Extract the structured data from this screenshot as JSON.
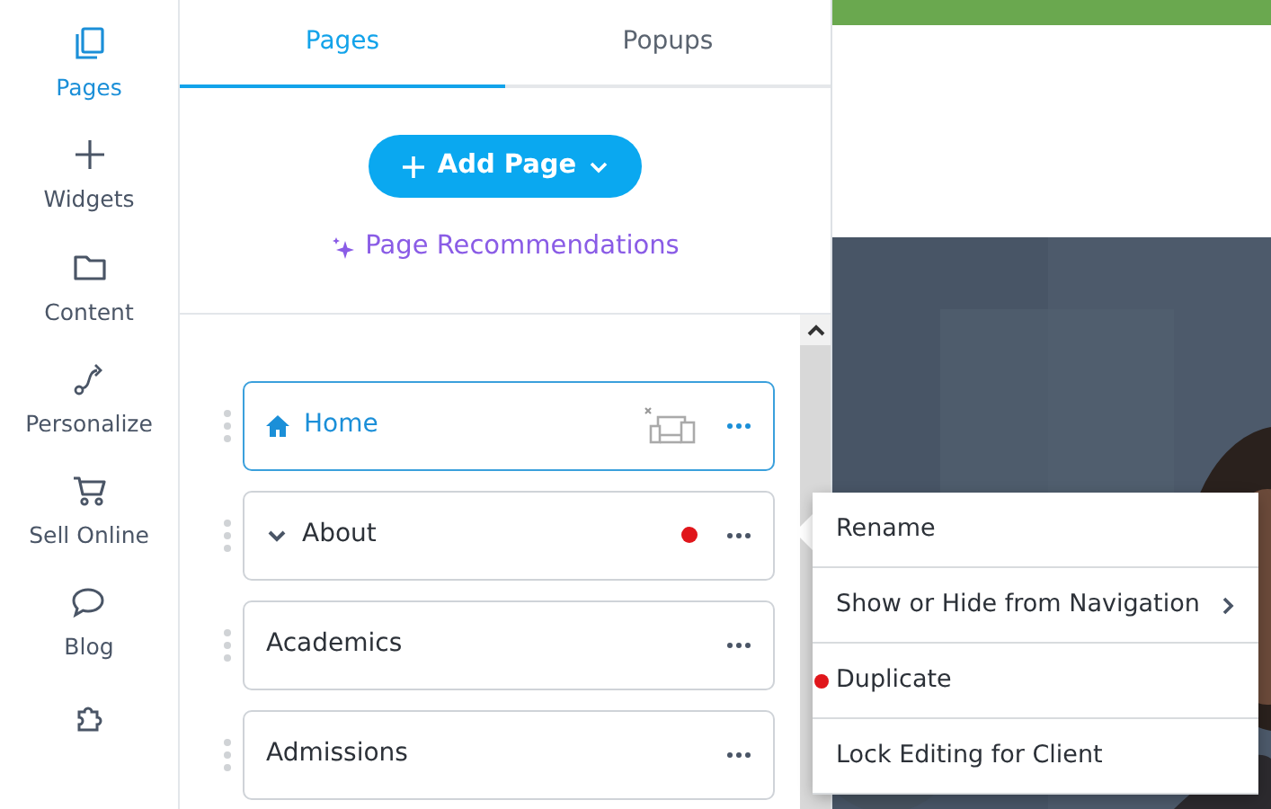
{
  "rail": {
    "items": [
      {
        "label": "Pages",
        "selected": true
      },
      {
        "label": "Widgets",
        "selected": false
      },
      {
        "label": "Content",
        "selected": false
      },
      {
        "label": "Personalize",
        "selected": false
      },
      {
        "label": "Sell Online",
        "selected": false
      },
      {
        "label": "Blog",
        "selected": false
      },
      {
        "selected": false
      }
    ]
  },
  "tabs": [
    {
      "label": "Pages",
      "selected": true
    },
    {
      "label": "Popups",
      "selected": false
    }
  ],
  "add_button": {
    "label": "Add Page"
  },
  "recommendations_link": {
    "label": "Page Recommendations"
  },
  "pages": [
    {
      "label": "Home",
      "kind": "home",
      "selected": true,
      "notification": false
    },
    {
      "label": "About",
      "kind": "folder",
      "selected": false,
      "notification": true
    },
    {
      "label": "Academics",
      "kind": "page",
      "selected": false,
      "notification": false
    },
    {
      "label": "Admissions",
      "kind": "page",
      "selected": false,
      "notification": false
    }
  ],
  "context_menu": {
    "items": [
      {
        "label": "Rename",
        "submenu": false,
        "notification": false
      },
      {
        "label": "Show or Hide from Navigation",
        "submenu": true,
        "notification": false
      },
      {
        "label": "Duplicate",
        "submenu": false,
        "notification": true
      },
      {
        "label": "Lock Editing for Client",
        "submenu": false,
        "notification": false
      }
    ]
  }
}
